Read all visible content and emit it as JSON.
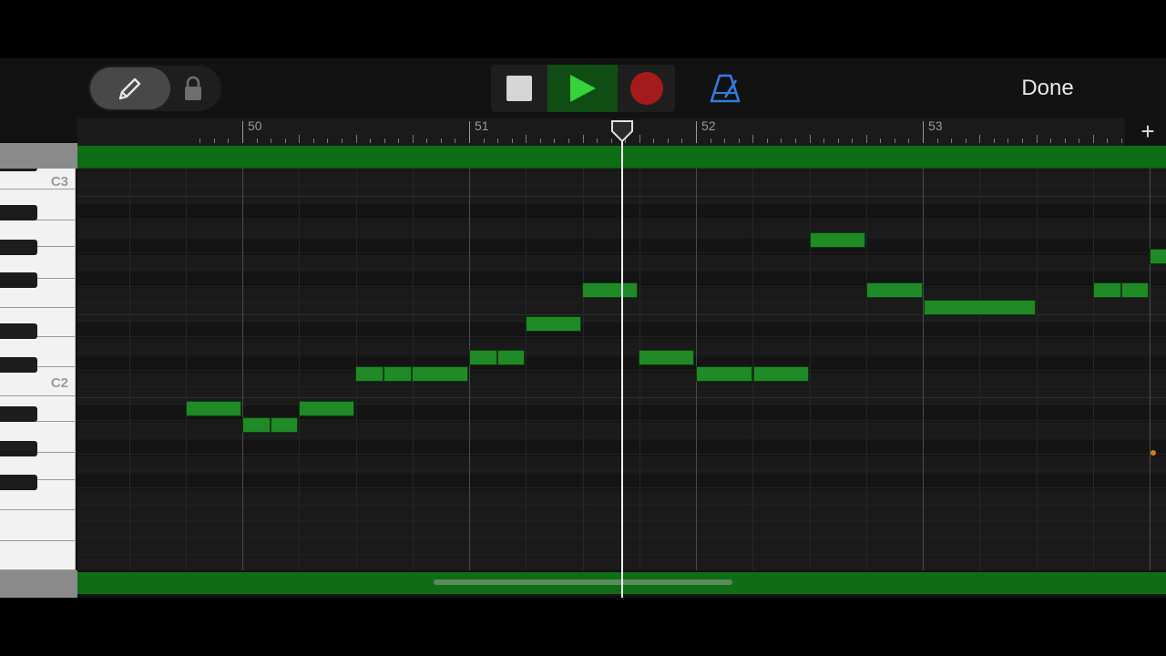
{
  "toolbar": {
    "pencil_icon": "pencil-icon",
    "lock_icon": "lock-icon",
    "stop_icon": "stop-icon",
    "play_icon": "play-icon",
    "record_icon": "record-icon",
    "metronome_icon": "metronome-icon",
    "done_label": "Done",
    "add_label": "+"
  },
  "ruler": {
    "bars": [
      "50",
      "51",
      "52",
      "53"
    ]
  },
  "keyboard": {
    "labels": [
      "C3",
      "C2"
    ]
  },
  "colors": {
    "note": "#1f8a26",
    "region": "#0f6e15",
    "play": "#35d43a",
    "record": "#a31b1b",
    "metronome": "#2f7de0"
  }
}
